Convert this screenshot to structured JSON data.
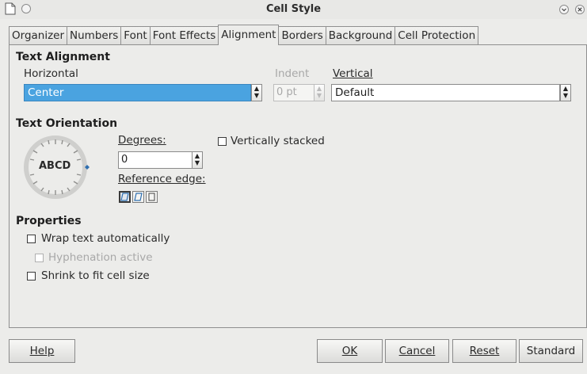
{
  "window": {
    "title": "Cell Style"
  },
  "tabs": [
    {
      "label": "Organizer"
    },
    {
      "label": "Numbers"
    },
    {
      "label": "Font"
    },
    {
      "label": "Font Effects"
    },
    {
      "label": "Alignment"
    },
    {
      "label": "Borders"
    },
    {
      "label": "Background"
    },
    {
      "label": "Cell Protection"
    }
  ],
  "active_tab": "Alignment",
  "text_alignment": {
    "title": "Text Alignment",
    "horizontal_label": "Horizontal",
    "horizontal_value": "Center",
    "indent_label": "Indent",
    "indent_value": "0 pt",
    "vertical_label": "Vertical",
    "vertical_value": "Default"
  },
  "text_orientation": {
    "title": "Text Orientation",
    "dial_text": "ABCD",
    "degrees_label": "Degrees:",
    "degrees_value": "0",
    "reference_edge_label": "Reference edge:",
    "vertically_stacked_label": "Vertically stacked"
  },
  "properties": {
    "title": "Properties",
    "wrap_text_label": "Wrap text automatically",
    "hyphenation_label": "Hyphenation active",
    "shrink_label": "Shrink to fit cell size"
  },
  "buttons": {
    "help": "Help",
    "ok": "OK",
    "cancel": "Cancel",
    "reset": "Reset",
    "standard": "Standard"
  },
  "colors": {
    "highlight": "#4aa3e0",
    "background": "#ececea"
  }
}
